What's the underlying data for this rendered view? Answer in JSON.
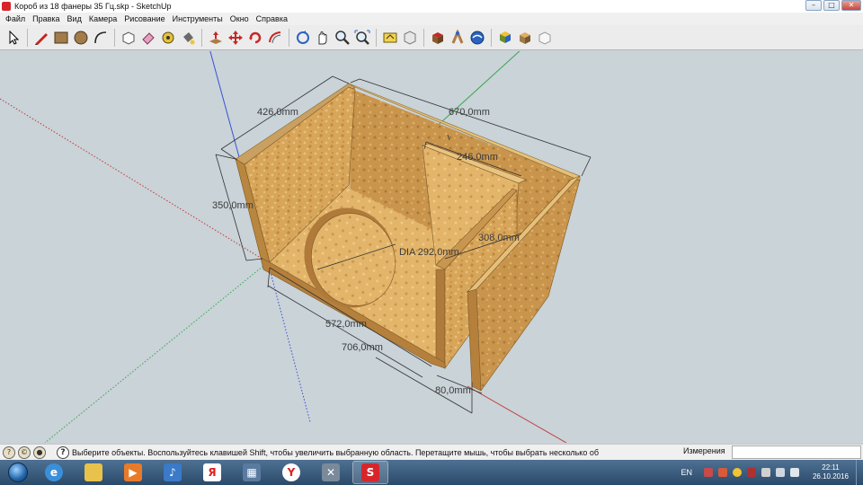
{
  "window": {
    "title": "Короб из 18 фанеры 35 Гц.skp - SketchUp",
    "controls": {
      "minimize": "–",
      "maximize": "□",
      "close": "✕"
    }
  },
  "menu": [
    "Файл",
    "Правка",
    "Вид",
    "Камера",
    "Рисование",
    "Инструменты",
    "Окно",
    "Справка"
  ],
  "toolbar": {
    "tools": [
      "select-tool-icon",
      "pencil-line-icon",
      "rectangle-icon",
      "circle-icon",
      "arc-icon",
      "make-component-icon",
      "eraser-icon",
      "tape-measure-icon",
      "paint-bucket-icon",
      "push-pull-icon",
      "move-icon",
      "rotate-icon",
      "offset-icon",
      "orbit-icon",
      "pan-icon",
      "zoom-icon",
      "zoom-extents-icon",
      "get-models-icon",
      "share-model-icon",
      "component-upload-icon",
      "extension-warehouse-icon",
      "photo-textures-icon",
      "styles-icon",
      "layout-icon",
      "export-icon"
    ]
  },
  "viewport": {
    "dimensions": {
      "width_top": "426,0mm",
      "depth_top": "670,0mm",
      "inner_depth": "246,0mm",
      "height": "350,0mm",
      "inner_height": "308,0mm",
      "diameter": "DIA 292,0mm",
      "width_bottom": "572,0mm",
      "length_bottom": "706,0mm",
      "port_width": "80,0mm"
    },
    "colors": {
      "background": "#c9d3d8",
      "wood": "#d9a85c",
      "axis_red": "#c23a3a",
      "axis_green": "#3aa64a",
      "axis_blue": "#3a4fd6"
    }
  },
  "status": {
    "message": "Выберите объекты. Воспользуйтесь клавишей Shift, чтобы увеличить выбранную область. Перетащите мышь, чтобы выбрать несколько об",
    "measure_label": "Измерения",
    "measure_value": ""
  },
  "taskbar": {
    "apps": [
      "explorer",
      "internet-explorer",
      "file-explorer",
      "media-player",
      "sound-mixer",
      "yandex",
      "calculator",
      "yandex-browser",
      "tools",
      "sketchup"
    ],
    "language": "EN",
    "time": "22:11",
    "date": "26.10.2016"
  }
}
